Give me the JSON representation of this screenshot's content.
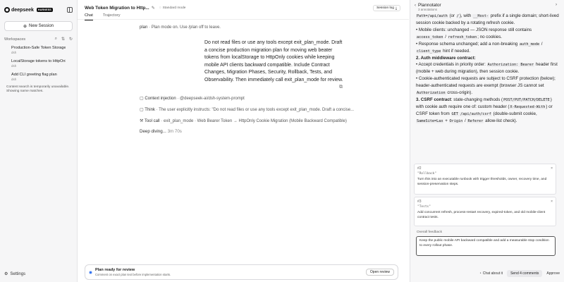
{
  "sidebar": {
    "logo_text": "deepseek",
    "logo_badge": "HARNESS",
    "new_session": "New Session",
    "workspaces_label": "Workspaces",
    "sessions": [
      {
        "title": "Production-Safe Token Storage ...",
        "sub": "dsh"
      },
      {
        "title": "LocalStorage tokens to HttpOnl...",
        "sub": "dsh"
      },
      {
        "title": "Add CLI greeting flag plan",
        "sub": "dsh"
      }
    ],
    "note": "Content search is temporarily unavailable. Showing name matches.",
    "settings": "Settings"
  },
  "header": {
    "title": "Web Token Migration to Http...",
    "mode": "Standard mode",
    "session_log": "Session log",
    "tabs": [
      "Chat",
      "Trajectory"
    ]
  },
  "main": {
    "plan_key": "plan",
    "plan_text": "Plan mode on. Use /plan off to leave.",
    "quote": "Do not read files or use any tools except exit_plan_mode. Draft a concise production migration plan for moving web beater tokens from localStorage to HttpOnly cookies while keeping mobile API clients backward compatible. Include Contract Changes, Migration Phases, Security, Rollback, Tests, and Observability. Then immediately call exit_plan_mode for review.",
    "context_key": "Context injection",
    "context_text": "@deepseek-ai/dsh-system-prompt",
    "think_key": "Think",
    "think_text": "The user explicitly instructs: \"Do not read files or use any tools except exit_plan_mode. Draft a concise...",
    "tool_key": "Tool call",
    "tool_text": "exit_plan_mode · Web Bearer Token → HttpOnly Cookie Migration (Mobile Backward Compatible)",
    "deep_label": "Deep diving...",
    "deep_meta": "3m 70s"
  },
  "banner": {
    "title": "Plan ready for review",
    "sub": "Comment on exact plan text before implementation starts.",
    "button": "Open review"
  },
  "panel": {
    "title": "Plannotator",
    "sub": "3 annotations",
    "comments": [
      {
        "num": "#2",
        "quote": "\"Rollback\"",
        "body": "Turn this into an executable runbook with trigger thresholds, owner, recovery time, and session-preservation steps."
      },
      {
        "num": "#3",
        "quote": "\"Tests\"",
        "body": "Add concurrent refresh, process-restart recovery, expired-token, and old mobile-client contract tests."
      }
    ],
    "feedback_label": "Overall feedback",
    "feedback_text": "Keep the public mobile API backward compatible and add a measurable stop condition to every rollout phase.",
    "chat_about": "Chat about it",
    "send": "Send 4 comments",
    "approve": "Approve"
  }
}
